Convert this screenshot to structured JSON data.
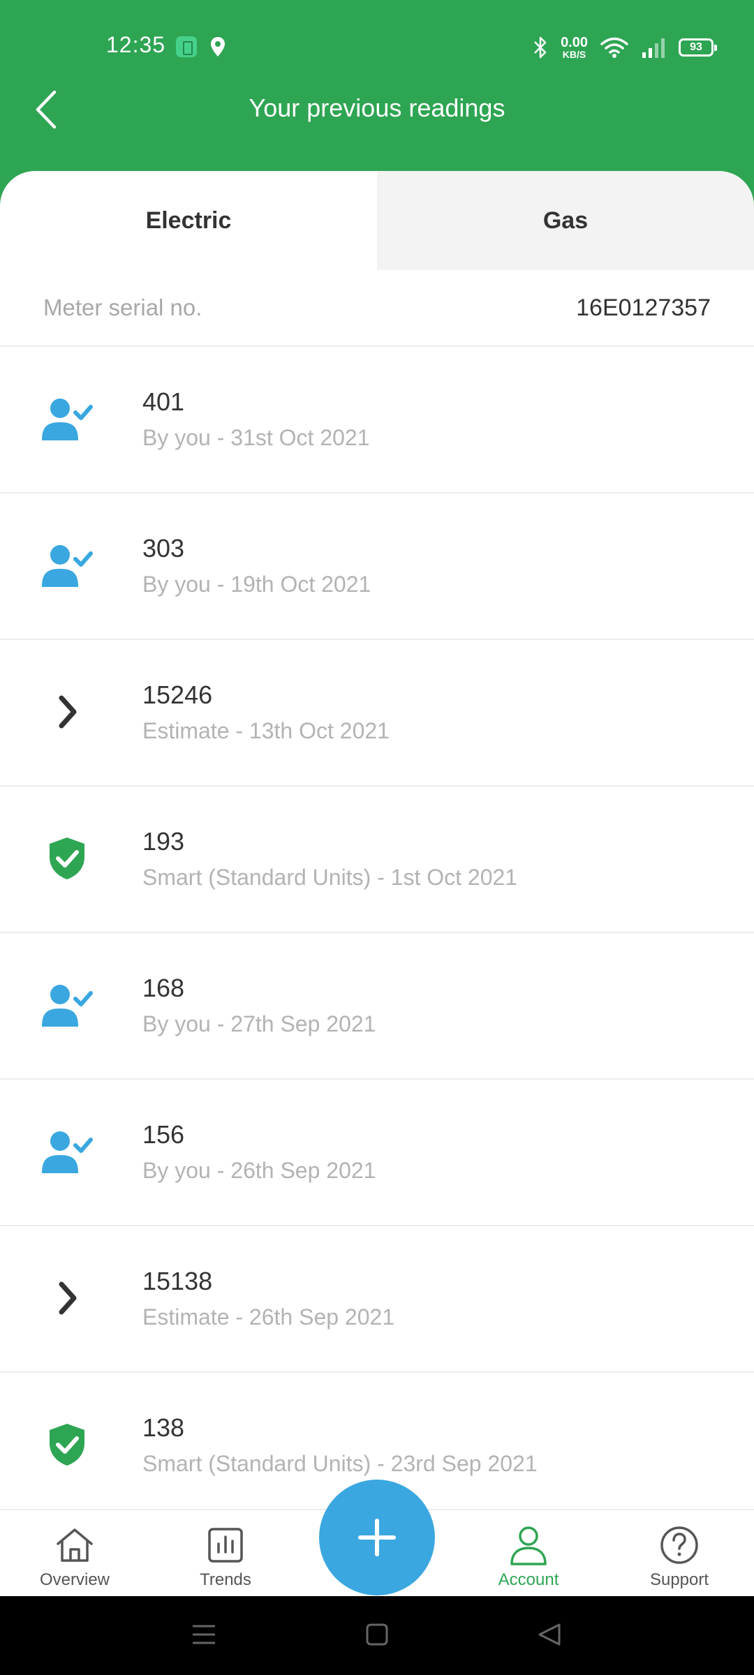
{
  "status_bar": {
    "time": "12:35",
    "net_speed_value": "0.00",
    "net_speed_unit": "KB/S",
    "battery": "93"
  },
  "header": {
    "title": "Your previous readings"
  },
  "tabs": [
    {
      "label": "Electric",
      "active": true
    },
    {
      "label": "Gas",
      "active": false
    }
  ],
  "meter": {
    "label": "Meter serial no.",
    "value": "16E0127357"
  },
  "readings": [
    {
      "value": "401",
      "detail": "By you - 31st Oct 2021",
      "icon": "user-check-icon"
    },
    {
      "value": "303",
      "detail": "By you - 19th Oct 2021",
      "icon": "user-check-icon"
    },
    {
      "value": "15246",
      "detail": "Estimate - 13th Oct 2021",
      "icon": "chevron-right-icon"
    },
    {
      "value": "193",
      "detail": "Smart (Standard Units) - 1st Oct 2021",
      "icon": "shield-check-icon"
    },
    {
      "value": "168",
      "detail": "By you - 27th Sep 2021",
      "icon": "user-check-icon"
    },
    {
      "value": "156",
      "detail": "By you - 26th Sep 2021",
      "icon": "user-check-icon"
    },
    {
      "value": "15138",
      "detail": "Estimate - 26th Sep 2021",
      "icon": "chevron-right-icon"
    },
    {
      "value": "138",
      "detail": "Smart (Standard Units) - 23rd Sep 2021",
      "icon": "shield-check-icon"
    }
  ],
  "bottom_nav": {
    "items": [
      {
        "label": "Overview",
        "icon": "home-icon"
      },
      {
        "label": "Trends",
        "icon": "chart-icon"
      },
      {
        "label": "Account",
        "icon": "account-icon",
        "active": true
      },
      {
        "label": "Support",
        "icon": "help-icon"
      }
    ],
    "fab_icon": "plus-icon"
  },
  "colors": {
    "brand_green": "#2ea553",
    "accent_blue": "#3aa7e0"
  }
}
